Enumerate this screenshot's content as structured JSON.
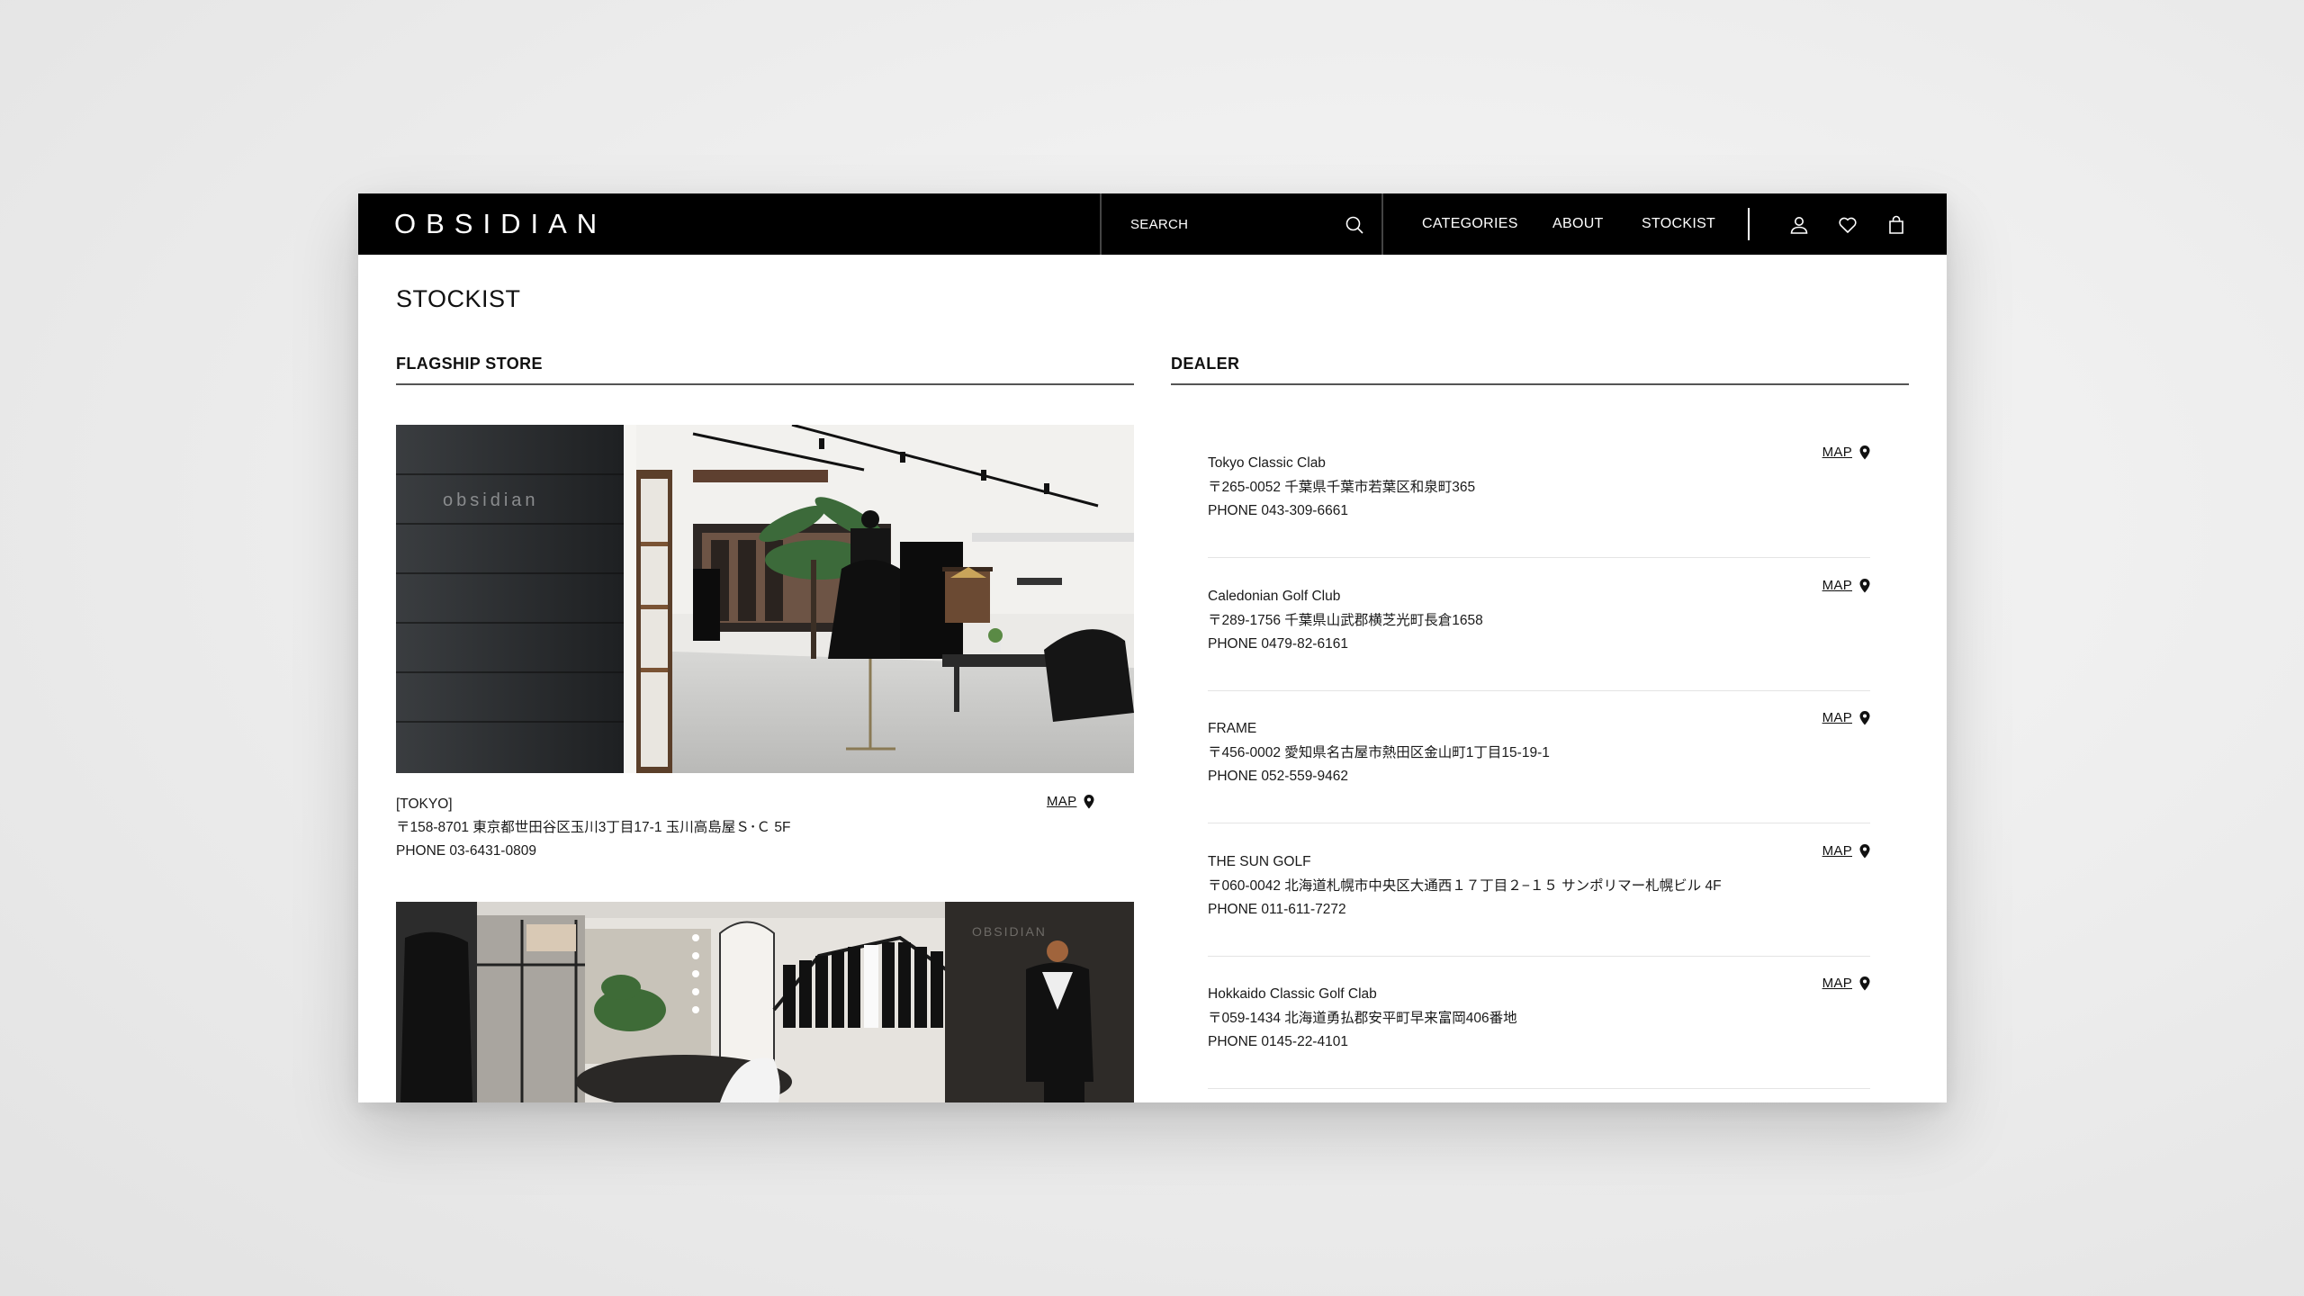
{
  "header": {
    "logo": "OBSIDIAN",
    "search_placeholder": "SEARCH",
    "nav": [
      "CATEGORIES",
      "ABOUT",
      "STOCKIST"
    ],
    "icons": [
      "account-icon",
      "wishlist-heart-icon",
      "shopping-bag-icon"
    ]
  },
  "page": {
    "title": "STOCKIST",
    "flagship_heading": "FLAGSHIP STORE",
    "dealer_heading": "DEALER"
  },
  "flagship_stores": [
    {
      "name": "[TOKYO]",
      "address": "〒158-8701 東京都世田谷区玉川3丁目17-1 玉川高島屋Ｓ･Ｃ 5F",
      "phone": "PHONE 03-6431-0809",
      "map_label": "MAP",
      "sign_text": "obsidian"
    },
    {
      "sign_text": "OBSIDIAN"
    }
  ],
  "dealers": [
    {
      "name": "Tokyo Classic Clab",
      "address": "〒265-0052 千葉県千葉市若葉区和泉町365",
      "phone": "PHONE 043-309-6661",
      "map_label": "MAP"
    },
    {
      "name": "Caledonian Golf Club",
      "address": "〒289-1756 千葉県山武郡横芝光町長倉1658",
      "phone": "PHONE 0479-82-6161",
      "map_label": "MAP"
    },
    {
      "name": "FRAME",
      "address": "〒456-0002 愛知県名古屋市熱田区金山町1丁目15-19-1",
      "phone": "PHONE 052-559-9462",
      "map_label": "MAP"
    },
    {
      "name": "THE SUN GOLF",
      "address": "〒060-0042 北海道札幌市中央区大通西１７丁目２−１５ サンポリマー札幌ビル 4F",
      "phone": "PHONE 011-611-7272",
      "map_label": "MAP"
    },
    {
      "name": "Hokkaido Classic Golf Clab",
      "address": "〒059-1434 北海道勇払郡安平町早来富岡406番地",
      "phone": "PHONE 0145-22-4101",
      "map_label": "MAP"
    }
  ],
  "colors": {
    "header_bg": "#000000",
    "page_bg": "#ffffff",
    "text": "#111111",
    "divider": "#555555"
  }
}
